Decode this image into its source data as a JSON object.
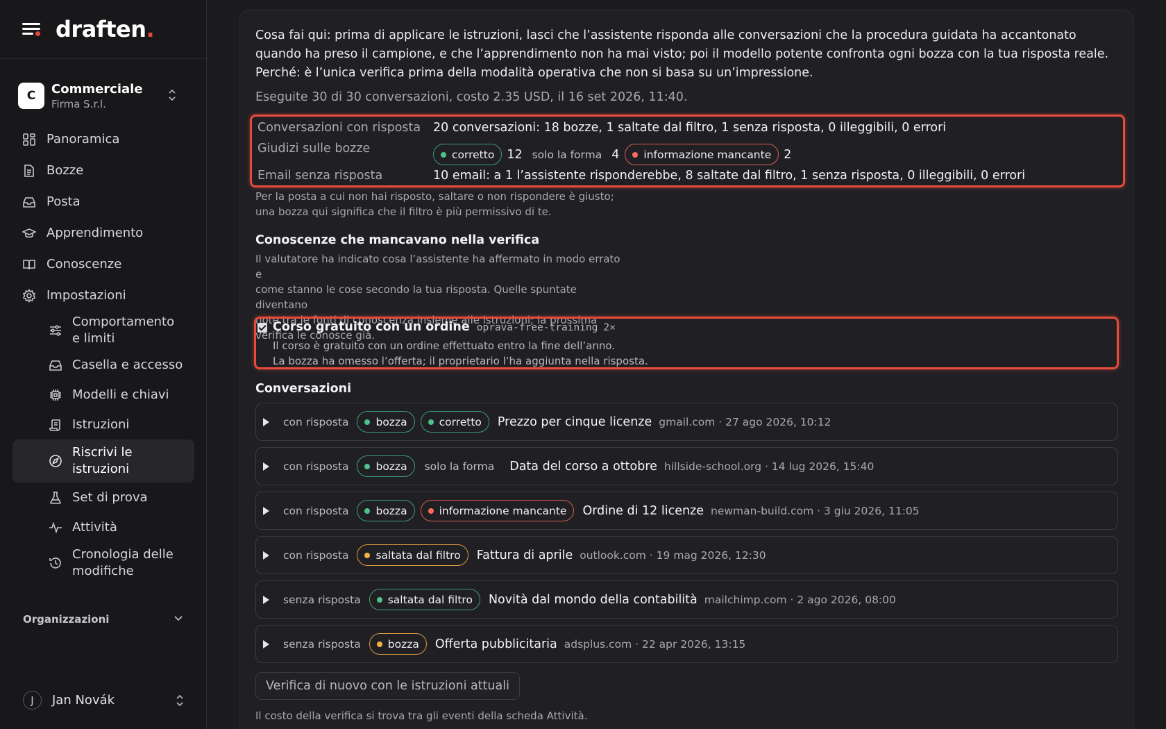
{
  "brand": {
    "name": "draften",
    "dot": "."
  },
  "org": {
    "initial": "C",
    "name": "Commerciale",
    "company": "Firma S.r.l."
  },
  "nav": [
    {
      "label": "Panoramica",
      "icon": "dashboard-icon"
    },
    {
      "label": "Bozze",
      "icon": "document-icon"
    },
    {
      "label": "Posta",
      "icon": "inbox-icon"
    },
    {
      "label": "Apprendimento",
      "icon": "graduation-cap-icon"
    },
    {
      "label": "Conoscenze",
      "icon": "book-icon"
    },
    {
      "label": "Impostazioni",
      "icon": "gear-icon"
    }
  ],
  "settings_sub": [
    {
      "label": "Comportamento e limiti",
      "icon": "sliders-icon"
    },
    {
      "label": "Casella e accesso",
      "icon": "inbox-icon"
    },
    {
      "label": "Modelli e chiavi",
      "icon": "chip-icon"
    },
    {
      "label": "Istruzioni",
      "icon": "scroll-icon"
    },
    {
      "label": "Riscrivi le istruzioni",
      "icon": "compass-icon",
      "active": true
    },
    {
      "label": "Set di prova",
      "icon": "flask-icon"
    },
    {
      "label": "Attività",
      "icon": "activity-icon"
    },
    {
      "label": "Cronologia delle modifiche",
      "icon": "history-icon"
    }
  ],
  "orgs_label": "Organizzazioni",
  "user": {
    "initial": "J",
    "name": "Jan Novák"
  },
  "intro": "Cosa fai qui: prima di applicare le istruzioni, lasci che l’assistente risponda alle conversazioni che la procedura guidata ha accantonato quando ha preso il campione, e che l’apprendimento non ha mai visto; poi il modello potente confronta ogni bozza con la tua risposta reale. Perché: è l’unica verifica prima della modalità operativa che non si basa su un’impressione.",
  "run_line": "Eseguite 30 di 30 conversazioni, costo 2.35 USD, il 16 set 2026, 11:40.",
  "summary": {
    "replied_label": "Conversazioni con risposta",
    "replied_value": "20 conversazioni: 18 bozze, 1 saltate dal filtro, 1 senza risposta, 0 illeggibili, 0 errori",
    "judgments_label": "Giudizi sulle bozze",
    "correct_label": "corretto",
    "correct_count": "12",
    "form_label": "solo la forma",
    "form_count": "4",
    "missing_label": "informazione mancante",
    "missing_count": "2",
    "unanswered_label": "Email senza risposta",
    "unanswered_value": "10 email: a 1 l’assistente risponderebbe, 8 saltate dal filtro, 1 senza risposta, 0 illeggibili, 0 errori"
  },
  "hint_line1": "Per la posta a cui non hai risposto, saltare o non rispondere è giusto;",
  "hint_line2": "una bozza qui significa che il filtro è più permissivo di te.",
  "knowledge": {
    "title": "Conoscenze che mancavano nella verifica",
    "desc_lines": [
      "Il valutatore ha indicato cosa l’assistente ha affermato in modo errato e",
      "come stanno le cose secondo la tua risposta. Quelle spuntate diventano",
      "note tra le fonti di conoscenza insieme alle istruzioni; la prossima",
      "verifica le conosce già."
    ],
    "item": {
      "name": "Corso gratuito con un ordine",
      "code": "oprava-free-training",
      "count": "2×",
      "line1": "Il corso è gratuito con un ordine effettuato entro la fine dell’anno.",
      "line2": "La bozza ha omesso l’offerta; il proprietario l’ha aggiunta nella risposta."
    }
  },
  "conversations": {
    "title": "Conversazioni",
    "rows": [
      {
        "status": "con risposta",
        "tags": [
          {
            "label": "bozza",
            "color": "green"
          },
          {
            "label": "corretto",
            "color": "green"
          }
        ],
        "subject": "Prezzo per cinque licenze",
        "meta": "gmail.com · 27 ago 2026, 10:12"
      },
      {
        "status": "con risposta",
        "tags": [
          {
            "label": "bozza",
            "color": "green"
          },
          {
            "label": "solo la forma",
            "color": "plain"
          }
        ],
        "subject": "Data del corso a ottobre",
        "meta": "hillside-school.org · 14 lug 2026, 15:40"
      },
      {
        "status": "con risposta",
        "tags": [
          {
            "label": "bozza",
            "color": "green"
          },
          {
            "label": "informazione mancante",
            "color": "red"
          }
        ],
        "subject": "Ordine di 12 licenze",
        "meta": "newman-build.com · 3 giu 2026, 11:05"
      },
      {
        "status": "con risposta",
        "tags": [
          {
            "label": "saltata dal filtro",
            "color": "amber"
          }
        ],
        "subject": "Fattura di aprile",
        "meta": "outlook.com · 19 mag 2026, 12:30"
      },
      {
        "status": "senza risposta",
        "tags": [
          {
            "label": "saltata dal filtro",
            "color": "green"
          }
        ],
        "subject": "Novità dal mondo della contabilità",
        "meta": "mailchimp.com · 2 ago 2026, 08:00"
      },
      {
        "status": "senza risposta",
        "tags": [
          {
            "label": "bozza",
            "color": "amber"
          }
        ],
        "subject": "Offerta pubblicitaria",
        "meta": "adsplus.com · 22 apr 2026, 13:15"
      }
    ]
  },
  "recheck_button": "Verifica di nuovo con le istruzioni attuali",
  "footnote": "Il costo della verifica si trova tra gli eventi della scheda Attività."
}
